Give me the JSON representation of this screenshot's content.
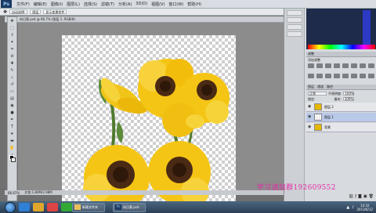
{
  "app": {
    "logo": "Ps"
  },
  "menubar": {
    "items": [
      "文件(F)",
      "编辑(E)",
      "图像(I)",
      "图层(L)",
      "选择(S)",
      "滤镜(T)",
      "分析(A)",
      "3D(D)",
      "视图(V)",
      "窗口(W)",
      "帮助(H)"
    ]
  },
  "options": {
    "items": [
      "自动选择:",
      "图层",
      "显示变换控件"
    ]
  },
  "document": {
    "tab": "向日葵.psd @ 66.7% (图层 1, RGB/8)",
    "status_zoom": "66.67%",
    "status_doc": "文档:1.86M/2.98M"
  },
  "panels": {
    "adjust_tab": "调整",
    "adjust_sub": "添加调整",
    "layers_tab": "图层",
    "channels_tab": "通道",
    "paths_tab": "路径",
    "blend_mode": "正常",
    "opacity_label": "不透明度:",
    "opacity": "100%",
    "lock_label": "锁定:",
    "fill_label": "填充:",
    "fill": "100%",
    "layers": [
      {
        "name": "图层 2",
        "selected": false
      },
      {
        "name": "图层 1",
        "selected": true
      },
      {
        "name": "背景",
        "selected": false
      }
    ]
  },
  "taskbar": {
    "apps": [
      "",
      "",
      "",
      ""
    ],
    "app_ps": "向日葵.psd",
    "app_folder": "新建文件夹",
    "clock_time": "14:32",
    "clock_date": "2013/6/12"
  },
  "watermark": "学习请加群192609552",
  "colors": {
    "accent": "#2c3ac6",
    "layer_selected": "#b9c9e8",
    "watermark": "#e52aa8"
  }
}
